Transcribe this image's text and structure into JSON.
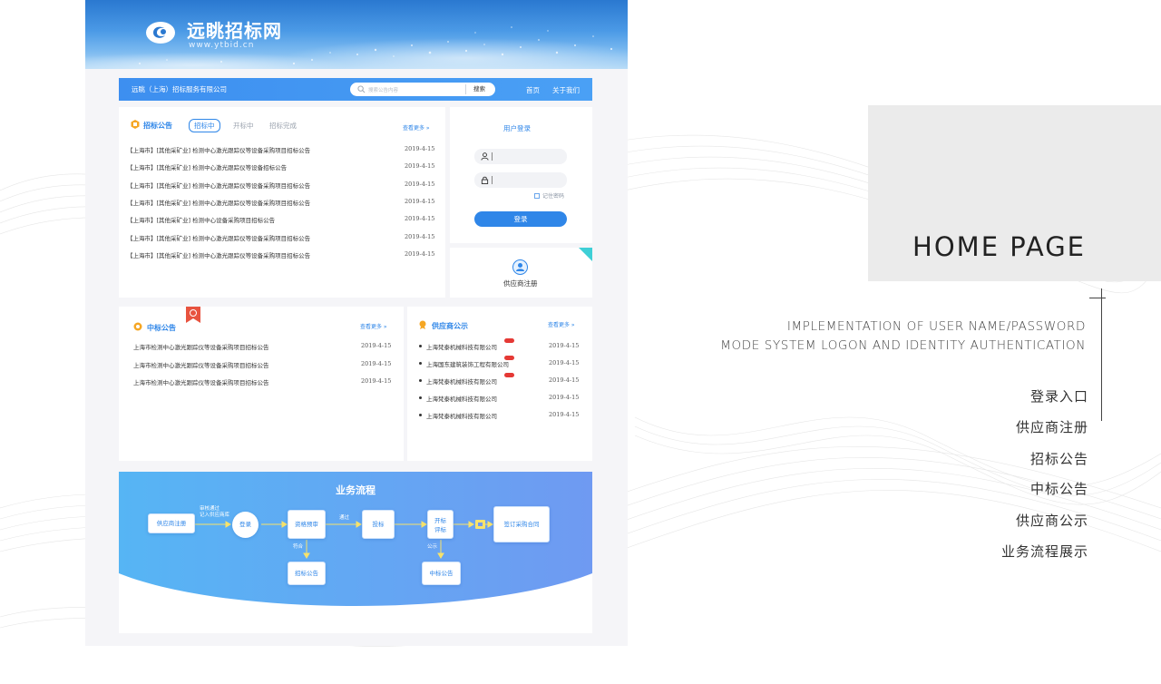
{
  "site": {
    "logo_title": "远眺招标网",
    "logo_url": "www.ytbid.cn",
    "nav": {
      "company": "远眺（上海）招标服务有限公司",
      "search_placeholder": "搜索公告内容",
      "search_button": "搜索",
      "links": [
        "首页",
        "关于我们"
      ]
    },
    "tender": {
      "title": "招标公告",
      "tabs": [
        "招标中",
        "开标中",
        "招标完成"
      ],
      "active_tab": "招标中",
      "more": "查看更多",
      "rows": [
        {
          "text": "【上海市】[其他采矿业] 检测中心激光跟踪仪等设备采购项目招标公告",
          "date": "2019-4-15"
        },
        {
          "text": "【上海市】[其他采矿业] 检测中心激光跟踪仪等设备招标公告",
          "date": "2019-4-15"
        },
        {
          "text": "【上海市】[其他采矿业] 检测中心激光跟踪仪等设备采购项目招标公告",
          "date": "2019-4-15"
        },
        {
          "text": "【上海市】[其他采矿业] 检测中心激光跟踪仪等设备采购项目招标公告",
          "date": "2019-4-15"
        },
        {
          "text": "【上海市】[其他采矿业] 检测中心设备采购项目招标公告",
          "date": "2019-4-15"
        },
        {
          "text": "【上海市】[其他采矿业] 检测中心激光跟踪仪等设备采购项目招标公告",
          "date": "2019-4-15"
        },
        {
          "text": "【上海市】[其他采矿业] 检测中心激光跟踪仪等设备采购项目招标公告",
          "date": "2019-4-15"
        }
      ]
    },
    "login": {
      "title": "用户登录",
      "remember": "记住密码",
      "button": "登录",
      "supplier_register": "供应商注册"
    },
    "award": {
      "title": "中标公告",
      "more": "查看更多",
      "rows": [
        {
          "text": "上海市检测中心激光跟踪仪等设备采购项目招标公告",
          "date": "2019-4-15"
        },
        {
          "text": "上海市检测中心激光跟踪仪等设备采购项目招标公告",
          "date": "2019-4-15"
        },
        {
          "text": "上海市检测中心激光跟踪仪等设备采购项目招标公告",
          "date": "2019-4-15"
        }
      ]
    },
    "supplier": {
      "title": "供应商公示",
      "more": "查看更多",
      "rows": [
        {
          "text": "上海梵泰机械科技有限公司",
          "date": "2019-4-15",
          "new": true
        },
        {
          "text": "上海国东建筑装饰工程有限公司",
          "date": "2019-4-15",
          "new": true
        },
        {
          "text": "上海梵泰机械科技有限公司",
          "date": "2019-4-15",
          "new": true
        },
        {
          "text": "上海梵泰机械科技有限公司",
          "date": "2019-4-15",
          "new": false
        },
        {
          "text": "上海梵泰机械科技有限公司",
          "date": "2019-4-15",
          "new": false
        }
      ]
    },
    "flow": {
      "title": "业务流程",
      "supplier_register": "供应商注册",
      "approved_label_1": "审核通过",
      "approved_label_2": "记入供应商库",
      "login": "登录",
      "prequal": "资格预审",
      "pass_label": "通过",
      "bid": "投标",
      "open_1": "开标",
      "open_2": "评标",
      "sign": "签订采购合同",
      "qualify_label": "符合",
      "tender_notice": "招标公告",
      "publish_label": "公示",
      "award_notice": "中标公告"
    }
  },
  "right": {
    "title": "HOME PAGE",
    "desc_line1": "IMPLEMENTATION OF USER NAME/PASSWORD",
    "desc_line2": "MODE SYSTEM LOGON AND IDENTITY AUTHENTICATION",
    "menu": [
      "登录入口",
      "供应商注册",
      "招标公告",
      "中标公告",
      "供应商公示",
      "业务流程展示"
    ]
  },
  "colors": {
    "accent": "#2f86e8",
    "nav": "#3d8ff0",
    "badge_new": "#e53935",
    "award_badge": "#e8533f"
  }
}
